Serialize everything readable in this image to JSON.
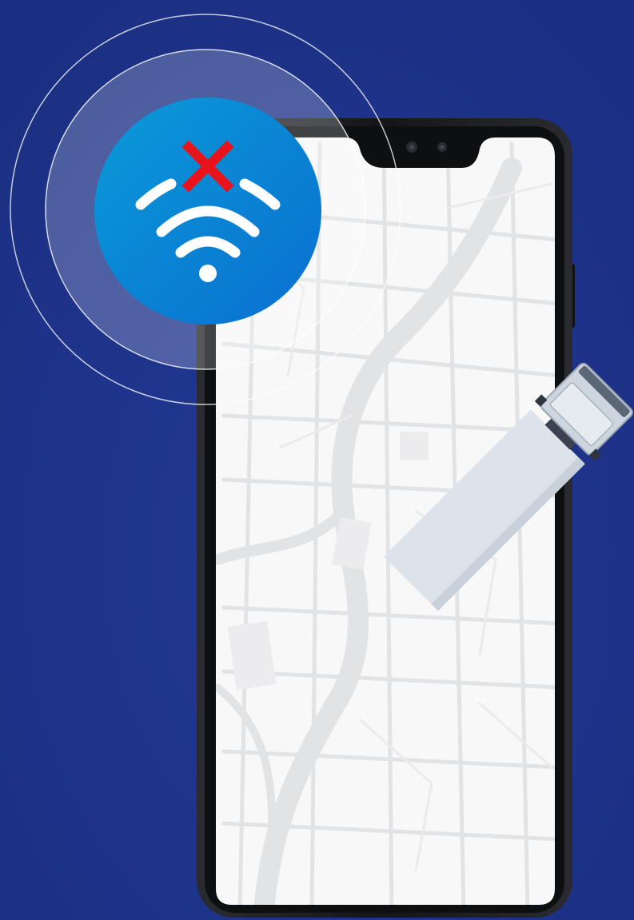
{
  "colors": {
    "background": "#1b2f82",
    "phone_frame": "#1c1d21",
    "phone_screen": "#f8f8f8",
    "map_roads": "#e2e3e5",
    "badge_gradient_start": "#0a9ad8",
    "badge_gradient_end": "#0a6fd0",
    "wifi_symbol": "#ffffff",
    "error_cross": "#e8141b",
    "truck_cab": "#cdd6df",
    "truck_trailer": "#dde3ea"
  },
  "icons": {
    "wifi": "wifi-icon",
    "error": "cross-icon",
    "truck": "truck-icon",
    "map": "map-icon"
  },
  "status": {
    "connectivity": "offline"
  }
}
